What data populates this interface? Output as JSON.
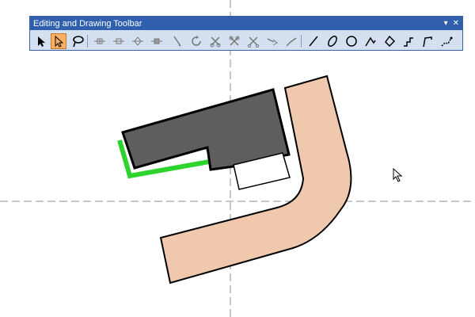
{
  "toolbar": {
    "title": "Editing and Drawing Toolbar",
    "menu_glyph": "▾",
    "close_glyph": "✕",
    "tools": [
      {
        "name": "select-arrow-icon",
        "active": false
      },
      {
        "name": "edit-tool-icon",
        "active": true
      },
      {
        "name": "lasso-select-icon",
        "active": false
      },
      {
        "name": "insert-vertex-icon",
        "active": false
      },
      {
        "name": "delete-vertex-icon",
        "active": false
      },
      {
        "name": "move-vertex-icon",
        "active": false
      },
      {
        "name": "remove-vertex-icon",
        "active": false
      },
      {
        "name": "reshape-icon",
        "active": false
      },
      {
        "name": "rotate-icon",
        "active": false
      },
      {
        "name": "split-icon",
        "active": false
      },
      {
        "name": "trim-icon",
        "active": false
      },
      {
        "name": "cut-icon",
        "active": false
      },
      {
        "name": "extend-icon",
        "active": false
      },
      {
        "name": "reshape-line-icon",
        "active": false
      },
      {
        "name": "line-icon",
        "active": false
      },
      {
        "name": "ellipse-icon",
        "active": false
      },
      {
        "name": "circle-icon",
        "active": false
      },
      {
        "name": "polyline-icon",
        "active": false
      },
      {
        "name": "polygon-icon",
        "active": false
      },
      {
        "name": "stepped-line-icon",
        "active": false
      },
      {
        "name": "trace-icon",
        "active": false
      },
      {
        "name": "streaming-icon",
        "active": false
      }
    ]
  },
  "map": {
    "colors": {
      "background": "#ffffff",
      "building_fill": "#5e5e5e",
      "building_outline": "#000000",
      "green_edge": "#2ed42e",
      "road_fill": "#f0c8ad",
      "road_outline": "#000000",
      "crosshair": "#909090",
      "snap_line": "#b0a8d8"
    }
  }
}
